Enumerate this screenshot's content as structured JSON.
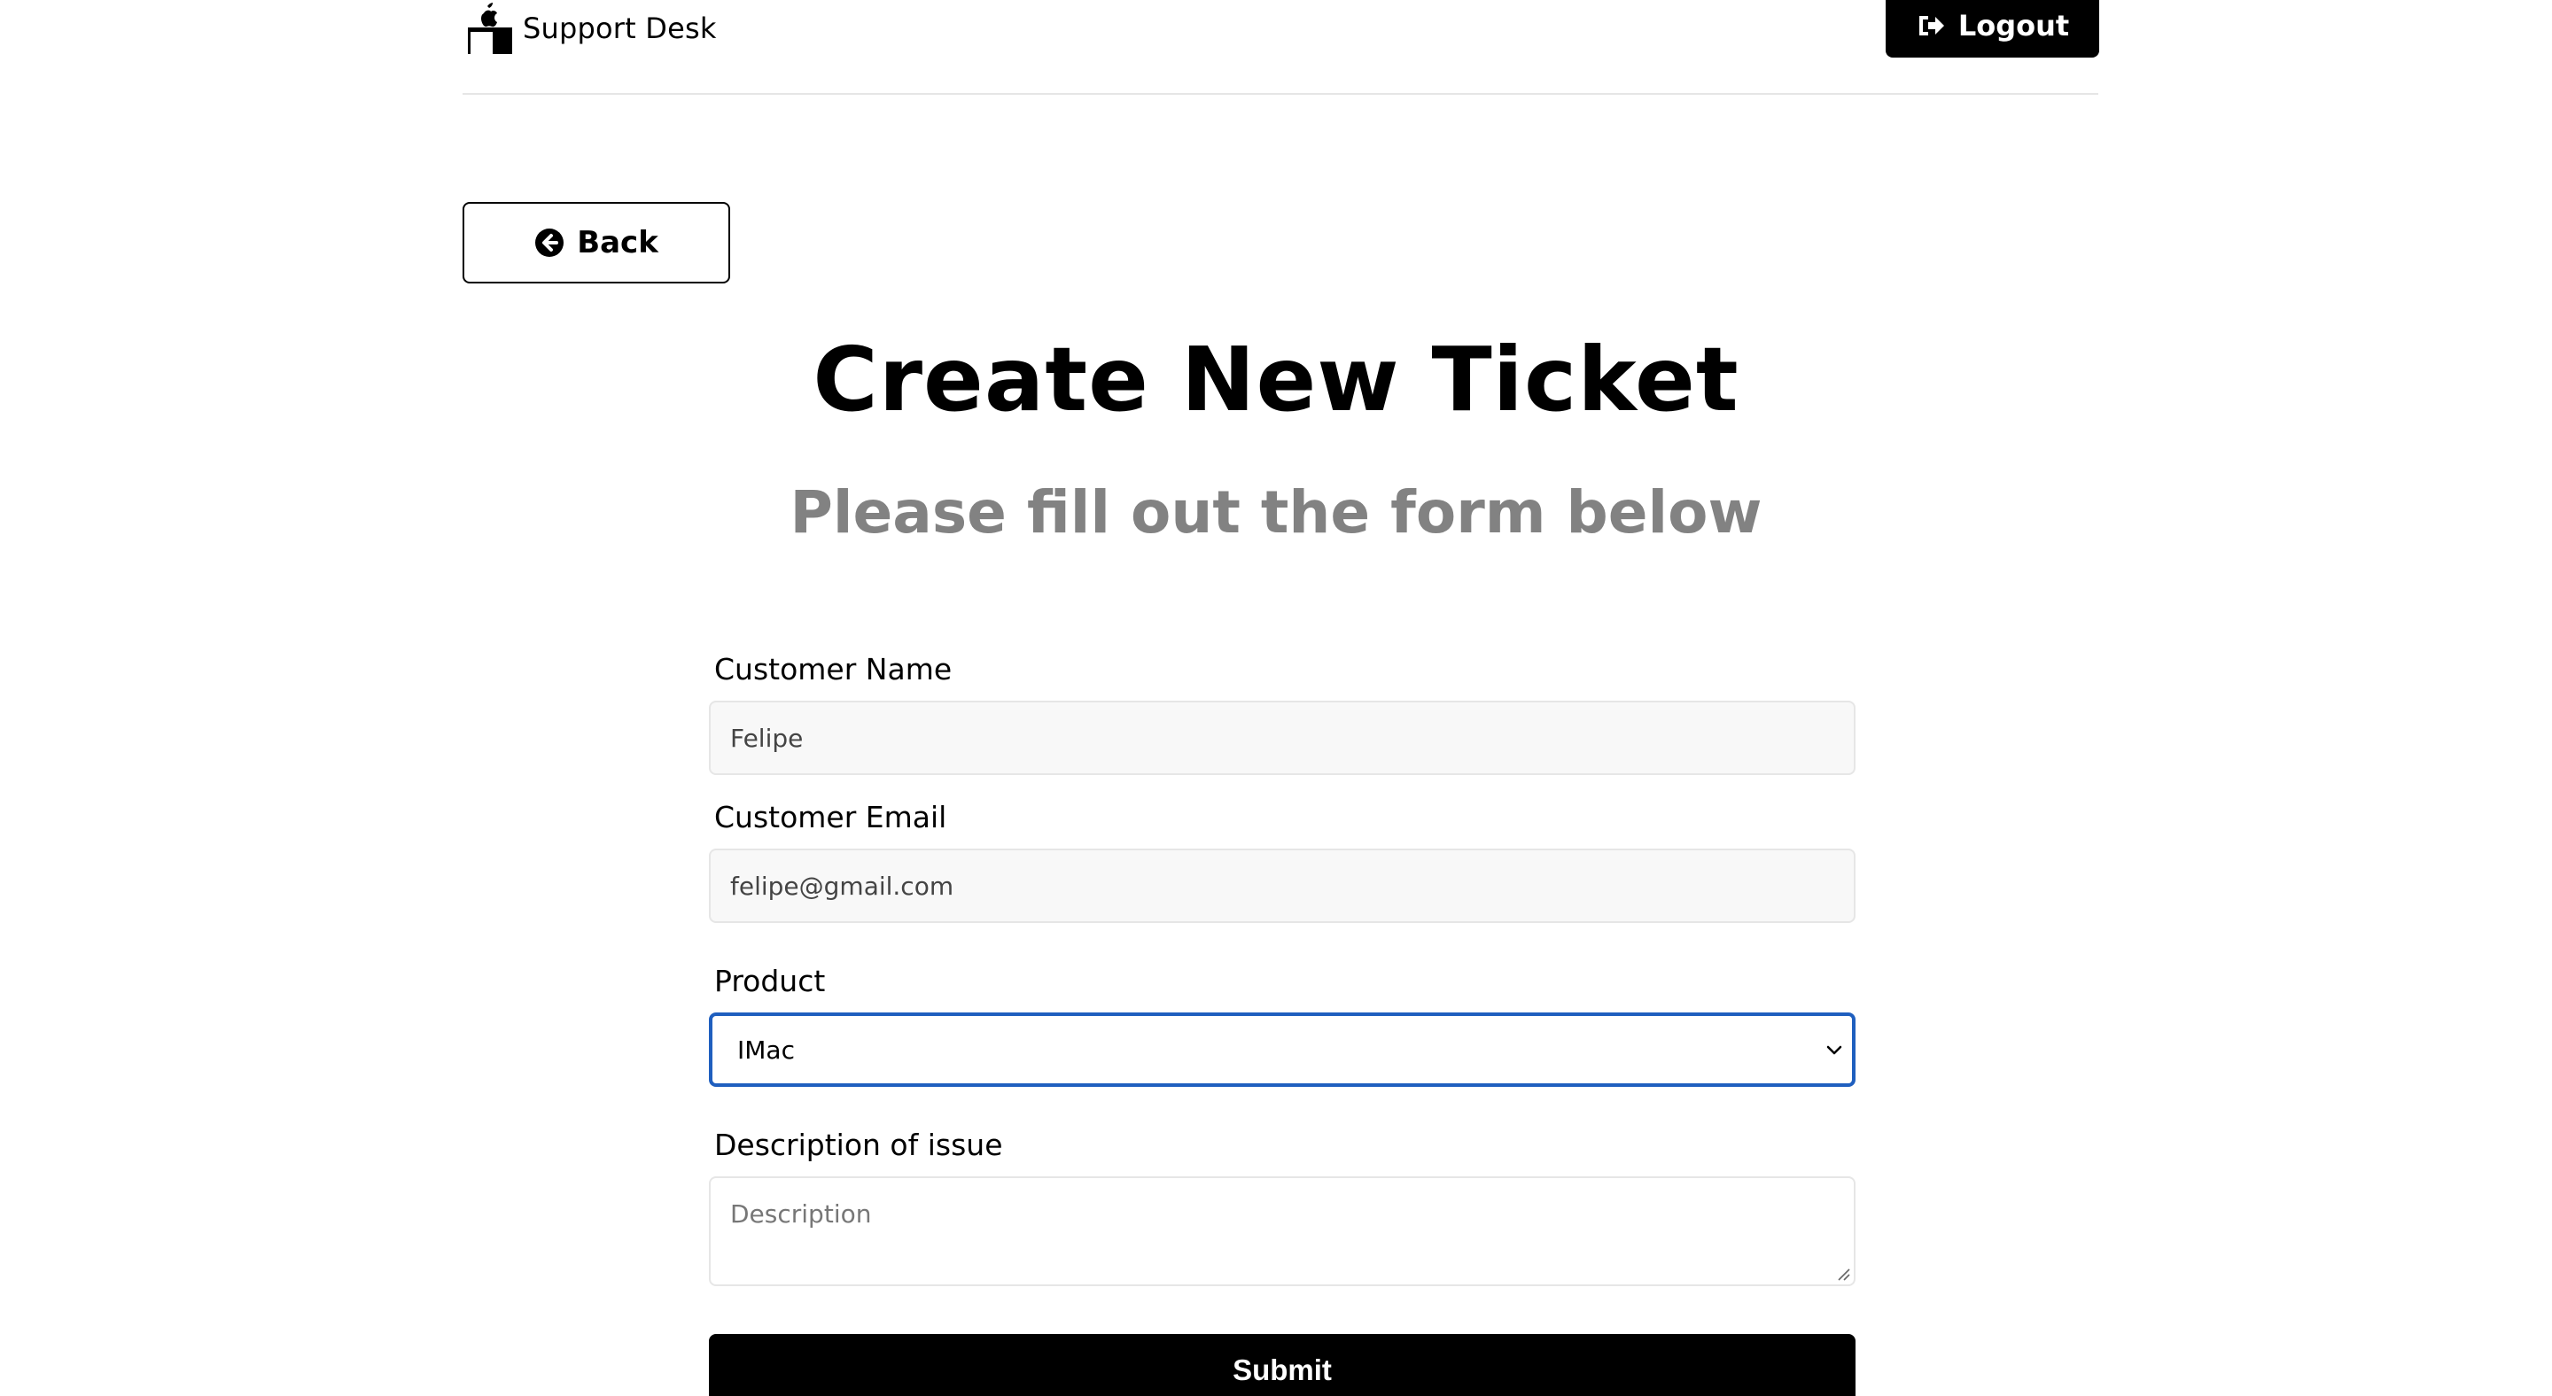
{
  "header": {
    "brand_label": "Support Desk",
    "brand_icon": "desk-icon",
    "logout_label": "Logout",
    "logout_icon": "sign-out-icon"
  },
  "back": {
    "label": "Back",
    "icon": "arrow-circle-left-icon"
  },
  "main": {
    "title": "Create New Ticket",
    "subtitle": "Please fill out the form below"
  },
  "form": {
    "name": {
      "label": "Customer Name",
      "value": "Felipe"
    },
    "email": {
      "label": "Customer Email",
      "value": "felipe@gmail.com"
    },
    "product": {
      "label": "Product",
      "selected": "IMac",
      "focus_color": "#1f5fbf"
    },
    "description": {
      "label": "Description of issue",
      "placeholder": "Description",
      "value": ""
    },
    "submit_label": "Submit"
  },
  "colors": {
    "primary": "#000000",
    "subtitle": "#828282",
    "input_bg": "#f8f8f8",
    "border": "#e6e6e6"
  }
}
